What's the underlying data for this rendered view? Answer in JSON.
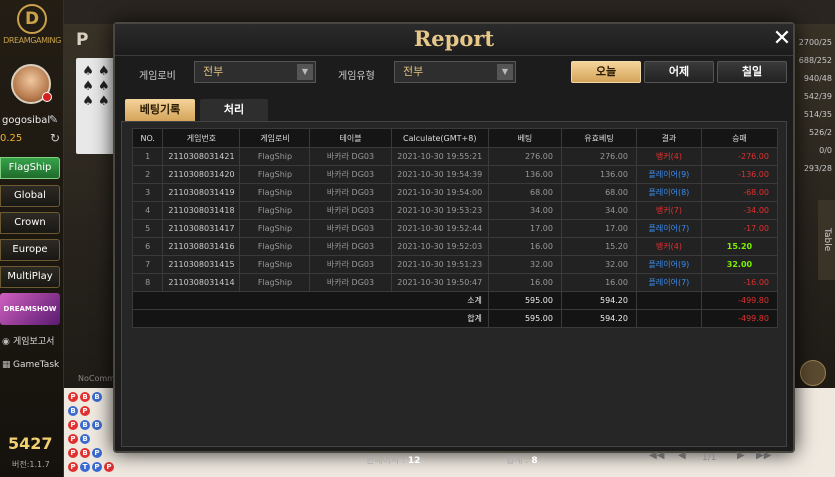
{
  "sidebar": {
    "logo_text": "DREAMGAMING",
    "username": "gogosibal",
    "balance": "0.25",
    "lobbies": [
      "FlagShip",
      "Global",
      "Crown",
      "Europe",
      "MultiPlay"
    ],
    "promo_text": "DREAMSHOW",
    "links": [
      "게임보고서",
      "GameTask"
    ],
    "score": "5427",
    "version": "버전:1.1.7"
  },
  "background": {
    "p_marker": "P",
    "no_comm": "NoComm",
    "right_values": [
      "2700/25",
      "688/252",
      "940/48",
      "542/39",
      "514/35",
      "526/2",
      "0/0",
      "293/28"
    ],
    "table_tab": "Table"
  },
  "modal": {
    "title": "Report",
    "filters": {
      "lobby_label": "게임로비",
      "lobby_value": "전부",
      "type_label": "게임유형",
      "type_value": "전부"
    },
    "day_buttons": [
      "오늘",
      "어제",
      "칠일"
    ],
    "tabs": [
      "베팅기록",
      "처리"
    ],
    "table": {
      "headers": [
        "NO.",
        "게임번호",
        "게임로비",
        "테이블",
        "Calculate(GMT+8)",
        "베팅",
        "유효베팅",
        "결과",
        "승패"
      ],
      "rows": [
        {
          "no": "1",
          "game_id": "2110308031421",
          "lobby": "FlagShip",
          "table": "바카라 DG03",
          "time": "2021-10-30 19:55:21",
          "bet": "276.00",
          "valid": "276.00",
          "result": "뱅커(4)",
          "result_type": "banker",
          "win": "-276.00",
          "win_type": "neg"
        },
        {
          "no": "2",
          "game_id": "2110308031420",
          "lobby": "FlagShip",
          "table": "바카라 DG03",
          "time": "2021-10-30 19:54:39",
          "bet": "136.00",
          "valid": "136.00",
          "result": "플레이어(9)",
          "result_type": "player",
          "win": "-136.00",
          "win_type": "neg"
        },
        {
          "no": "3",
          "game_id": "2110308031419",
          "lobby": "FlagShip",
          "table": "바카라 DG03",
          "time": "2021-10-30 19:54:00",
          "bet": "68.00",
          "valid": "68.00",
          "result": "플레이어(8)",
          "result_type": "player",
          "win": "-68.00",
          "win_type": "neg"
        },
        {
          "no": "4",
          "game_id": "2110308031418",
          "lobby": "FlagShip",
          "table": "바카라 DG03",
          "time": "2021-10-30 19:53:23",
          "bet": "34.00",
          "valid": "34.00",
          "result": "뱅커(7)",
          "result_type": "banker",
          "win": "-34.00",
          "win_type": "neg"
        },
        {
          "no": "5",
          "game_id": "2110308031417",
          "lobby": "FlagShip",
          "table": "바카라 DG03",
          "time": "2021-10-30 19:52:44",
          "bet": "17.00",
          "valid": "17.00",
          "result": "플레이어(7)",
          "result_type": "player",
          "win": "-17.00",
          "win_type": "neg"
        },
        {
          "no": "6",
          "game_id": "2110308031416",
          "lobby": "FlagShip",
          "table": "바카라 DG03",
          "time": "2021-10-30 19:52:03",
          "bet": "16.00",
          "valid": "15.20",
          "result": "뱅커(4)",
          "result_type": "banker",
          "win": "15.20",
          "win_type": "pos"
        },
        {
          "no": "7",
          "game_id": "2110308031415",
          "lobby": "FlagShip",
          "table": "바카라 DG03",
          "time": "2021-10-30 19:51:23",
          "bet": "32.00",
          "valid": "32.00",
          "result": "플레이어(9)",
          "result_type": "player",
          "win": "32.00",
          "win_type": "pos"
        },
        {
          "no": "8",
          "game_id": "2110308031414",
          "lobby": "FlagShip",
          "table": "바카라 DG03",
          "time": "2021-10-30 19:50:47",
          "bet": "16.00",
          "valid": "16.00",
          "result": "플레이어(7)",
          "result_type": "player",
          "win": "-16.00",
          "win_type": "neg"
        }
      ],
      "subtotal": {
        "label": "소계",
        "bet": "595.00",
        "valid": "594.20",
        "win": "-499.80"
      },
      "total": {
        "label": "합계",
        "bet": "595.00",
        "valid": "594.20",
        "win": "-499.80"
      }
    },
    "footer": {
      "per_page_label": "한페이지 :",
      "per_page_value": "12",
      "total_label": "합계 :",
      "total_value": "8",
      "page": "1/1"
    }
  }
}
